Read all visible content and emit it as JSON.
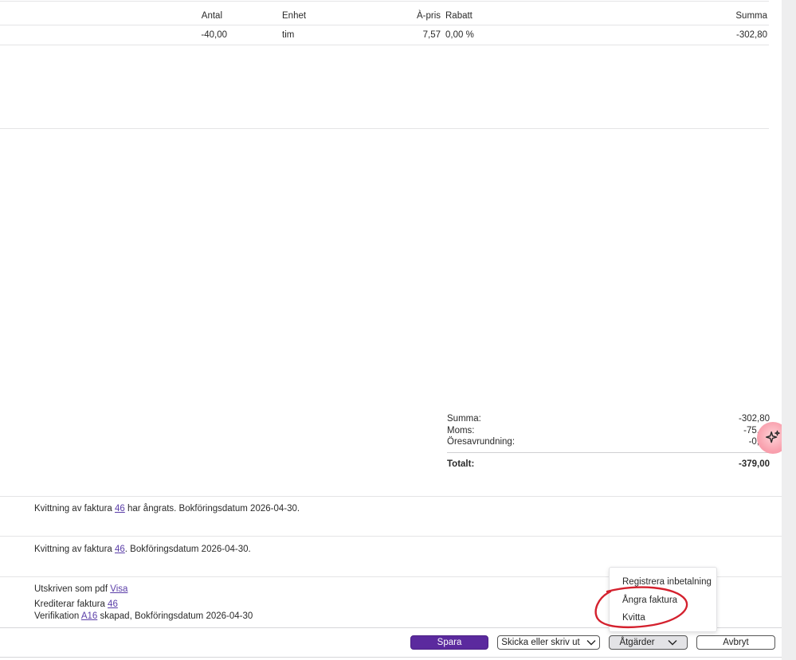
{
  "table": {
    "headers": {
      "antal": "Antal",
      "enhet": "Enhet",
      "apris": "À-pris",
      "rabatt": "Rabatt",
      "summa": "Summa"
    },
    "rows": [
      {
        "antal": "-40,00",
        "enhet": "tim",
        "apris": "7,57",
        "rabatt": "0,00 %",
        "summa": "-302,80"
      }
    ]
  },
  "totals": {
    "summa_label": "Summa:",
    "summa_value": "-302,80",
    "moms_label": "Moms:",
    "moms_value": "-75,",
    "ores_label": "Öresavrundning:",
    "ores_value": "-0,",
    "totalt_label": "Totalt:",
    "totalt_value": "-379,00"
  },
  "history": {
    "entry1": {
      "prefix": "Kvittning av faktura ",
      "link": "46",
      "suffix": " har ångrats. Bokföringsdatum 2026-04-30."
    },
    "entry2": {
      "prefix": "Kvittning av faktura ",
      "link": "46",
      "suffix": ". Bokföringsdatum 2026-04-30."
    },
    "entry3": {
      "line1_prefix": "Utskriven som pdf ",
      "line1_link": "Visa",
      "line2_prefix": "Krediterar faktura ",
      "line2_link": "46",
      "line3_prefix": "Verifikation ",
      "line3_link": "A16",
      "line3_suffix": " skapad, Bokföringsdatum 2026-04-30"
    }
  },
  "dropdown": {
    "items": [
      "Registrera inbetalning",
      "Ångra faktura",
      "Kvitta"
    ]
  },
  "toolbar": {
    "save_label": "Spara",
    "send_label": "Skicka eller skriv ut",
    "actions_label": "Åtgärder",
    "cancel_label": "Avbryt"
  },
  "colors": {
    "primary": "#5b2a9e",
    "link": "#5b3ea8",
    "annotation": "#d4212e",
    "ai_bubble": "#f9a3b0"
  },
  "icons": {
    "ai": "sparkle-icon",
    "chevron": "chevron-down-icon"
  }
}
